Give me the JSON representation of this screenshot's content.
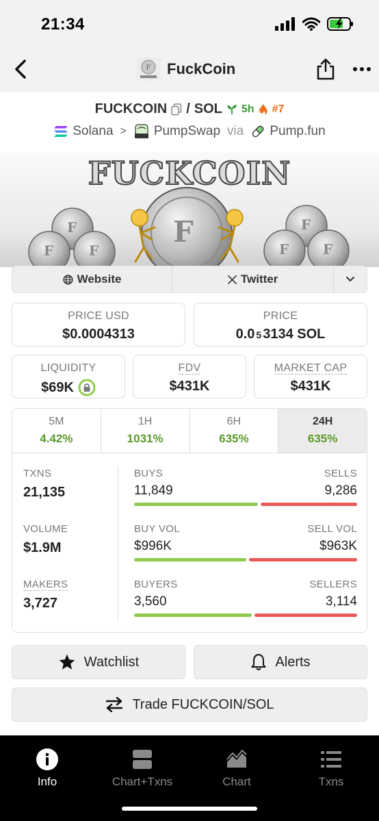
{
  "status_bar": {
    "time": "21:34"
  },
  "nav": {
    "title": "FuckCoin",
    "logo_text": "FUCKCOIN"
  },
  "pair": {
    "base": "FUCKCOIN",
    "separator": "/",
    "quote": "SOL",
    "age": "5h",
    "rank": "#7",
    "chain": "Solana",
    "dex": "PumpSwap",
    "via_label": "via",
    "launchpad": "Pump.fun",
    "chevron": ">"
  },
  "banner": {
    "title": "FUCKCOIN",
    "coin_letter": "F"
  },
  "links": {
    "website": "Website",
    "twitter": "Twitter"
  },
  "cards": {
    "price_usd": {
      "label": "PRICE USD",
      "value": "$0.0004313"
    },
    "price": {
      "label": "PRICE",
      "value_prefix": "0.0",
      "value_sub": "5",
      "value_suffix": "3134 SOL"
    },
    "liquidity": {
      "label": "LIQUIDITY",
      "value": "$69K"
    },
    "fdv": {
      "label": "FDV",
      "value": "$431K"
    },
    "market_cap": {
      "label": "MARKET CAP",
      "value": "$431K"
    }
  },
  "timeframes": [
    {
      "label": "5M",
      "value": "4.42%"
    },
    {
      "label": "1H",
      "value": "1031%"
    },
    {
      "label": "6H",
      "value": "635%"
    },
    {
      "label": "24H",
      "value": "635%"
    }
  ],
  "stats": {
    "txns": {
      "label": "TXNS",
      "value": "21,135"
    },
    "volume": {
      "label": "VOLUME",
      "value": "$1.9M"
    },
    "makers": {
      "label": "MAKERS",
      "value": "3,727"
    },
    "buys": {
      "label": "BUYS",
      "value": "11,849",
      "ratio": 0.561
    },
    "sells": {
      "label": "SELLS",
      "value": "9,286"
    },
    "buy_vol": {
      "label": "BUY VOL",
      "value": "$996K",
      "ratio": 0.508
    },
    "sell_vol": {
      "label": "SELL VOL",
      "value": "$963K"
    },
    "buyers": {
      "label": "BUYERS",
      "value": "3,560",
      "ratio": 0.533
    },
    "sellers": {
      "label": "SELLERS",
      "value": "3,114"
    }
  },
  "actions": {
    "watchlist": "Watchlist",
    "alerts": "Alerts",
    "trade": "Trade FUCKCOIN/SOL"
  },
  "tabs": [
    {
      "label": "Info"
    },
    {
      "label": "Chart+Txns"
    },
    {
      "label": "Chart"
    },
    {
      "label": "Txns"
    }
  ],
  "colors": {
    "buy_green": "#8ecb4f",
    "sell_red": "#e85a5a",
    "positive_text": "#5a9a2a",
    "age_green": "#3c9a3c",
    "rank_orange": "#ef6c1a"
  }
}
